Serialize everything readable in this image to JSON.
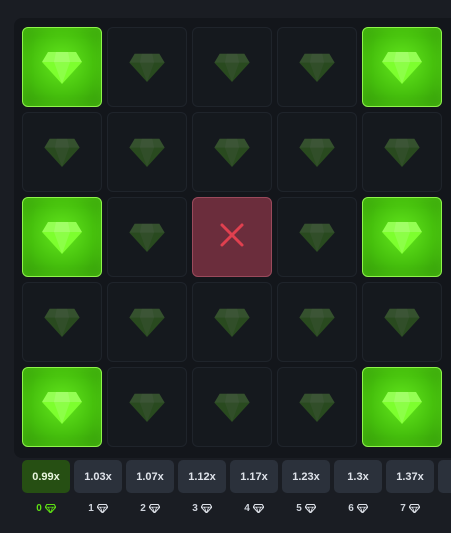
{
  "board": {
    "tiles": [
      "gem",
      "hidden",
      "hidden",
      "hidden",
      "gem",
      "hidden",
      "hidden",
      "hidden",
      "hidden",
      "hidden",
      "gem",
      "hidden",
      "mine",
      "hidden",
      "gem",
      "hidden",
      "hidden",
      "hidden",
      "hidden",
      "hidden",
      "gem",
      "hidden",
      "hidden",
      "hidden",
      "gem"
    ],
    "mine_symbol": "✕"
  },
  "multipliers": [
    "0.99x",
    "1.03x",
    "1.07x",
    "1.12x",
    "1.17x",
    "1.23x",
    "1.3x",
    "1.37x"
  ],
  "gem_counts": [
    "0",
    "1",
    "2",
    "3",
    "4",
    "5",
    "6",
    "7"
  ],
  "active_index": 0,
  "colors": {
    "gem_bright": "#63e81d",
    "gem_dim": "#2f5b1e",
    "mine_bg": "#6b2d3c",
    "mine_x": "#e0404f",
    "active_multiplier": "#264f13",
    "active_count": "#5ee014"
  },
  "icons": {
    "tile": "diamond-icon",
    "mine": "close-icon",
    "count": "diamond-icon"
  }
}
